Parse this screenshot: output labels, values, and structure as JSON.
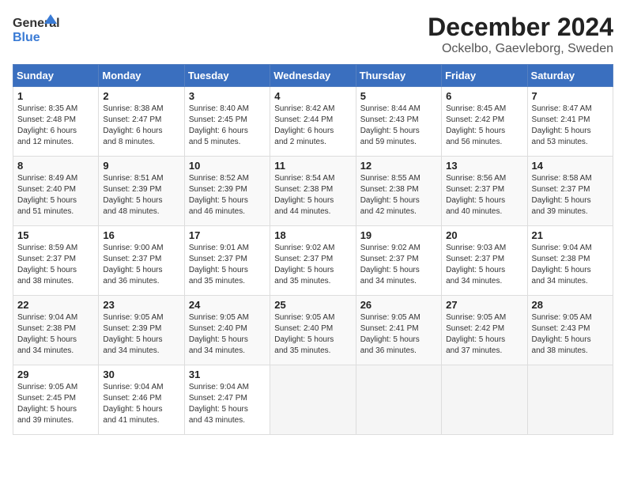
{
  "logo": {
    "text_general": "General",
    "text_blue": "Blue"
  },
  "title": "December 2024",
  "subtitle": "Ockelbo, Gaevleborg, Sweden",
  "headers": [
    "Sunday",
    "Monday",
    "Tuesday",
    "Wednesday",
    "Thursday",
    "Friday",
    "Saturday"
  ],
  "weeks": [
    [
      {
        "day": 1,
        "lines": [
          "Sunrise: 8:35 AM",
          "Sunset: 2:48 PM",
          "Daylight: 6 hours",
          "and 12 minutes."
        ]
      },
      {
        "day": 2,
        "lines": [
          "Sunrise: 8:38 AM",
          "Sunset: 2:47 PM",
          "Daylight: 6 hours",
          "and 8 minutes."
        ]
      },
      {
        "day": 3,
        "lines": [
          "Sunrise: 8:40 AM",
          "Sunset: 2:45 PM",
          "Daylight: 6 hours",
          "and 5 minutes."
        ]
      },
      {
        "day": 4,
        "lines": [
          "Sunrise: 8:42 AM",
          "Sunset: 2:44 PM",
          "Daylight: 6 hours",
          "and 2 minutes."
        ]
      },
      {
        "day": 5,
        "lines": [
          "Sunrise: 8:44 AM",
          "Sunset: 2:43 PM",
          "Daylight: 5 hours",
          "and 59 minutes."
        ]
      },
      {
        "day": 6,
        "lines": [
          "Sunrise: 8:45 AM",
          "Sunset: 2:42 PM",
          "Daylight: 5 hours",
          "and 56 minutes."
        ]
      },
      {
        "day": 7,
        "lines": [
          "Sunrise: 8:47 AM",
          "Sunset: 2:41 PM",
          "Daylight: 5 hours",
          "and 53 minutes."
        ]
      }
    ],
    [
      {
        "day": 8,
        "lines": [
          "Sunrise: 8:49 AM",
          "Sunset: 2:40 PM",
          "Daylight: 5 hours",
          "and 51 minutes."
        ]
      },
      {
        "day": 9,
        "lines": [
          "Sunrise: 8:51 AM",
          "Sunset: 2:39 PM",
          "Daylight: 5 hours",
          "and 48 minutes."
        ]
      },
      {
        "day": 10,
        "lines": [
          "Sunrise: 8:52 AM",
          "Sunset: 2:39 PM",
          "Daylight: 5 hours",
          "and 46 minutes."
        ]
      },
      {
        "day": 11,
        "lines": [
          "Sunrise: 8:54 AM",
          "Sunset: 2:38 PM",
          "Daylight: 5 hours",
          "and 44 minutes."
        ]
      },
      {
        "day": 12,
        "lines": [
          "Sunrise: 8:55 AM",
          "Sunset: 2:38 PM",
          "Daylight: 5 hours",
          "and 42 minutes."
        ]
      },
      {
        "day": 13,
        "lines": [
          "Sunrise: 8:56 AM",
          "Sunset: 2:37 PM",
          "Daylight: 5 hours",
          "and 40 minutes."
        ]
      },
      {
        "day": 14,
        "lines": [
          "Sunrise: 8:58 AM",
          "Sunset: 2:37 PM",
          "Daylight: 5 hours",
          "and 39 minutes."
        ]
      }
    ],
    [
      {
        "day": 15,
        "lines": [
          "Sunrise: 8:59 AM",
          "Sunset: 2:37 PM",
          "Daylight: 5 hours",
          "and 38 minutes."
        ]
      },
      {
        "day": 16,
        "lines": [
          "Sunrise: 9:00 AM",
          "Sunset: 2:37 PM",
          "Daylight: 5 hours",
          "and 36 minutes."
        ]
      },
      {
        "day": 17,
        "lines": [
          "Sunrise: 9:01 AM",
          "Sunset: 2:37 PM",
          "Daylight: 5 hours",
          "and 35 minutes."
        ]
      },
      {
        "day": 18,
        "lines": [
          "Sunrise: 9:02 AM",
          "Sunset: 2:37 PM",
          "Daylight: 5 hours",
          "and 35 minutes."
        ]
      },
      {
        "day": 19,
        "lines": [
          "Sunrise: 9:02 AM",
          "Sunset: 2:37 PM",
          "Daylight: 5 hours",
          "and 34 minutes."
        ]
      },
      {
        "day": 20,
        "lines": [
          "Sunrise: 9:03 AM",
          "Sunset: 2:37 PM",
          "Daylight: 5 hours",
          "and 34 minutes."
        ]
      },
      {
        "day": 21,
        "lines": [
          "Sunrise: 9:04 AM",
          "Sunset: 2:38 PM",
          "Daylight: 5 hours",
          "and 34 minutes."
        ]
      }
    ],
    [
      {
        "day": 22,
        "lines": [
          "Sunrise: 9:04 AM",
          "Sunset: 2:38 PM",
          "Daylight: 5 hours",
          "and 34 minutes."
        ]
      },
      {
        "day": 23,
        "lines": [
          "Sunrise: 9:05 AM",
          "Sunset: 2:39 PM",
          "Daylight: 5 hours",
          "and 34 minutes."
        ]
      },
      {
        "day": 24,
        "lines": [
          "Sunrise: 9:05 AM",
          "Sunset: 2:40 PM",
          "Daylight: 5 hours",
          "and 34 minutes."
        ]
      },
      {
        "day": 25,
        "lines": [
          "Sunrise: 9:05 AM",
          "Sunset: 2:40 PM",
          "Daylight: 5 hours",
          "and 35 minutes."
        ]
      },
      {
        "day": 26,
        "lines": [
          "Sunrise: 9:05 AM",
          "Sunset: 2:41 PM",
          "Daylight: 5 hours",
          "and 36 minutes."
        ]
      },
      {
        "day": 27,
        "lines": [
          "Sunrise: 9:05 AM",
          "Sunset: 2:42 PM",
          "Daylight: 5 hours",
          "and 37 minutes."
        ]
      },
      {
        "day": 28,
        "lines": [
          "Sunrise: 9:05 AM",
          "Sunset: 2:43 PM",
          "Daylight: 5 hours",
          "and 38 minutes."
        ]
      }
    ],
    [
      {
        "day": 29,
        "lines": [
          "Sunrise: 9:05 AM",
          "Sunset: 2:45 PM",
          "Daylight: 5 hours",
          "and 39 minutes."
        ]
      },
      {
        "day": 30,
        "lines": [
          "Sunrise: 9:04 AM",
          "Sunset: 2:46 PM",
          "Daylight: 5 hours",
          "and 41 minutes."
        ]
      },
      {
        "day": 31,
        "lines": [
          "Sunrise: 9:04 AM",
          "Sunset: 2:47 PM",
          "Daylight: 5 hours",
          "and 43 minutes."
        ]
      },
      null,
      null,
      null,
      null
    ]
  ]
}
